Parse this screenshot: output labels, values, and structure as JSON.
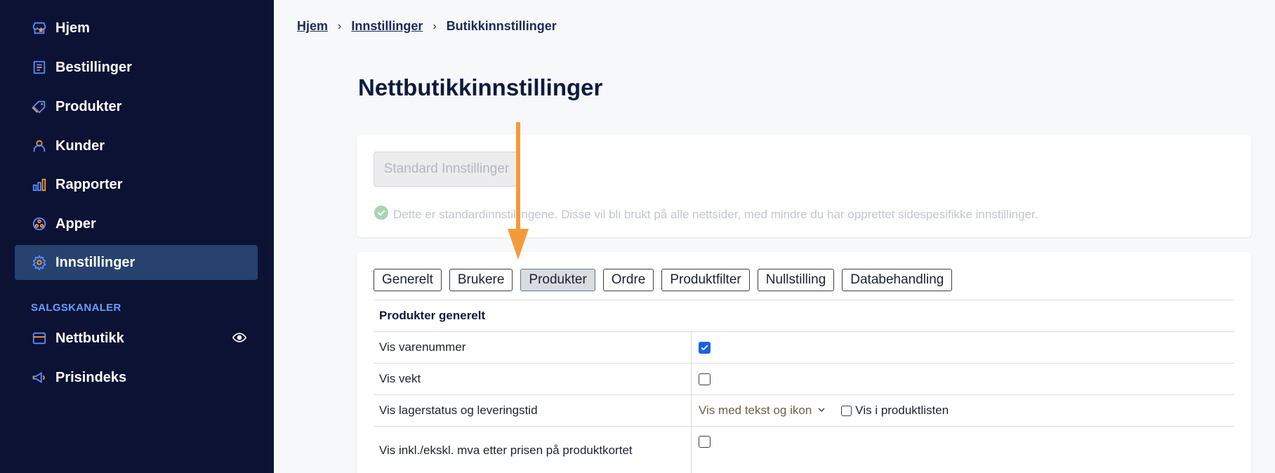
{
  "sidebar": {
    "items": [
      {
        "label": "Hjem",
        "icon": "store-icon"
      },
      {
        "label": "Bestillinger",
        "icon": "orders-icon"
      },
      {
        "label": "Produkter",
        "icon": "tag-icon"
      },
      {
        "label": "Kunder",
        "icon": "user-icon"
      },
      {
        "label": "Rapporter",
        "icon": "bar-chart-icon"
      },
      {
        "label": "Apper",
        "icon": "apps-icon"
      },
      {
        "label": "Innstillinger",
        "icon": "gear-icon",
        "active": true
      }
    ],
    "section_label": "SALGSKANALER",
    "channels": [
      {
        "label": "Nettbutikk",
        "icon": "shop-window-icon",
        "trailing_icon": "eye-icon"
      },
      {
        "label": "Prisindeks",
        "icon": "megaphone-icon"
      }
    ],
    "colors": {
      "background": "#0b1233",
      "active": "#27426e",
      "accent": "#6c9bff",
      "icon_orange": "#f59a3a"
    }
  },
  "breadcrumb": {
    "items": [
      "Hjem",
      "Innstillinger"
    ],
    "current": "Butikkinnstillinger"
  },
  "page": {
    "title": "Nettbutikkinnstillinger"
  },
  "standard_card": {
    "button_label": "Standard Innstillinger",
    "info_text": "Dette er standardinnstillingene. Disse vil bli brukt på alle nettsider, med mindre du har opprettet sidespesifikke innstillinger."
  },
  "tabs": [
    "Generelt",
    "Brukere",
    "Produkter",
    "Ordre",
    "Produktfilter",
    "Nullstilling",
    "Databehandling"
  ],
  "active_tab": "Produkter",
  "settings": {
    "section_title": "Produkter generelt",
    "rows": [
      {
        "label": "Vis varenummer",
        "checked": true
      },
      {
        "label": "Vis vekt",
        "checked": false
      },
      {
        "label": "Vis lagerstatus og leveringstid",
        "select_value": "Vis med tekst og ikon",
        "extra_check_label": "Vis i produktlisten",
        "extra_checked": false
      },
      {
        "label": "Vis inkl./ekskl. mva etter prisen på produktkortet",
        "checked": false
      }
    ]
  },
  "annotation": {
    "arrow_color": "#f59a3a"
  }
}
